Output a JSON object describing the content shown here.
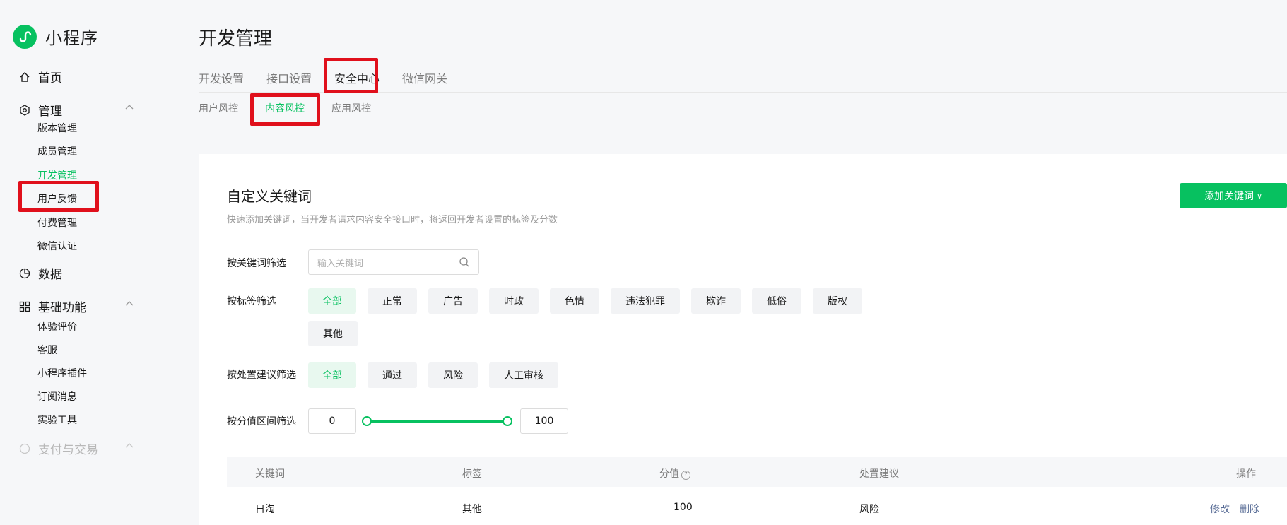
{
  "app": {
    "name": "小程序",
    "brand_color": "#07c160"
  },
  "sidebar": {
    "home": "首页",
    "manage": {
      "label": "管理",
      "items": [
        "版本管理",
        "成员管理",
        "开发管理",
        "用户反馈",
        "付费管理",
        "微信认证"
      ],
      "active": "开发管理"
    },
    "data": "数据",
    "basic": {
      "label": "基础功能",
      "items": [
        "体验评价",
        "客服",
        "小程序插件",
        "订阅消息",
        "实验工具"
      ]
    },
    "payment": "支付与交易"
  },
  "header": {
    "title": "开发管理",
    "tabs": [
      "开发设置",
      "接口设置",
      "安全中心",
      "微信网关"
    ],
    "active_tab": "安全中心",
    "subtabs": [
      "用户风控",
      "内容风控",
      "应用风控"
    ],
    "active_subtab": "内容风控"
  },
  "panel": {
    "title": "自定义关键词",
    "description": "快速添加关键词，当开发者请求内容安全接口时，将返回开发者设置的标签及分数",
    "add_button": "添加关键词",
    "filters": {
      "keyword_label": "按关键词筛选",
      "keyword_placeholder": "输入关键词",
      "tag_label": "按标签筛选",
      "tags": [
        "全部",
        "正常",
        "广告",
        "时政",
        "色情",
        "违法犯罪",
        "欺诈",
        "低俗",
        "版权",
        "其他"
      ],
      "tag_selected": "全部",
      "suggestion_label": "按处置建议筛选",
      "suggestions": [
        "全部",
        "通过",
        "风险",
        "人工审核"
      ],
      "suggestion_selected": "全部",
      "score_label": "按分值区间筛选",
      "score_min": "0",
      "score_max": "100"
    },
    "table": {
      "headers": {
        "keyword": "关键词",
        "tag": "标签",
        "score": "分值",
        "suggestion": "处置建议",
        "action": "操作"
      },
      "rows": [
        {
          "keyword": "日淘",
          "tag": "其他",
          "score": "100",
          "suggestion": "风险",
          "edit": "修改",
          "delete": "删除"
        }
      ]
    }
  },
  "colors": {
    "highlight": "#e0101c",
    "link": "#576b95"
  }
}
